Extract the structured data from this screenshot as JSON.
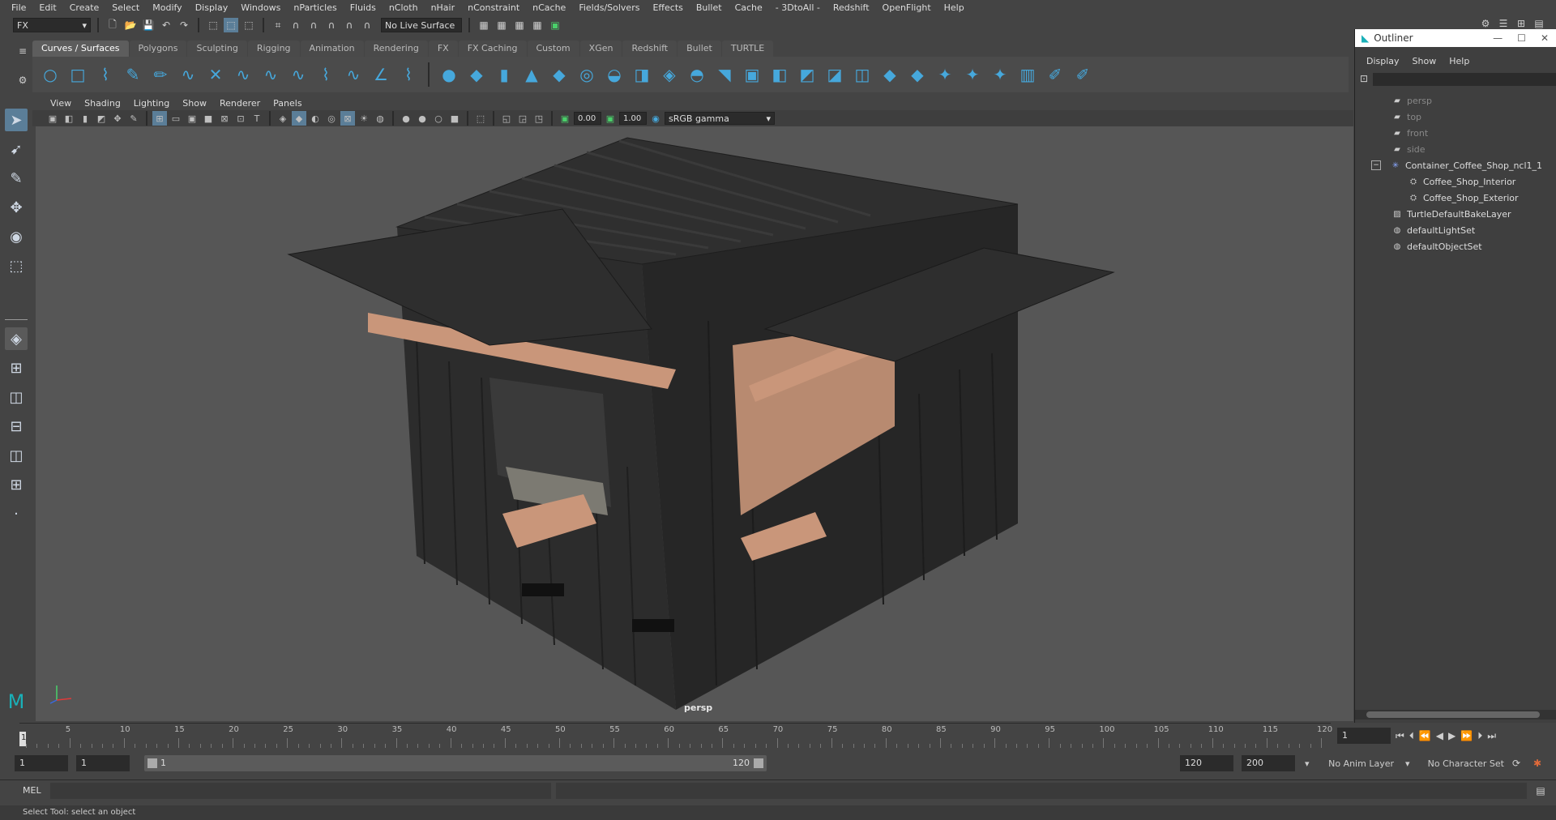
{
  "menubar": {
    "items": [
      "File",
      "Edit",
      "Create",
      "Select",
      "Modify",
      "Display",
      "Windows",
      "nParticles",
      "Fluids",
      "nCloth",
      "nHair",
      "nConstraint",
      "nCache",
      "Fields/Solvers",
      "Effects",
      "Bullet",
      "Cache",
      "- 3DtoAll -",
      "Redshift",
      "OpenFlight",
      "Help"
    ]
  },
  "toolbar": {
    "mode": "FX",
    "live_surface": "No Live Surface"
  },
  "shelf": {
    "tabs": [
      "Curves / Surfaces",
      "Polygons",
      "Sculpting",
      "Rigging",
      "Animation",
      "Rendering",
      "FX",
      "FX Caching",
      "Custom",
      "XGen",
      "Redshift",
      "Bullet",
      "TURTLE"
    ],
    "active_tab": "Curves / Surfaces"
  },
  "viewport": {
    "menu": [
      "View",
      "Shading",
      "Lighting",
      "Show",
      "Renderer",
      "Panels"
    ],
    "exposure": "0.00",
    "gamma": "1.00",
    "color_space": "sRGB gamma",
    "camera_label": "persp"
  },
  "outliner": {
    "title": "Outliner",
    "menu": [
      "Display",
      "Show",
      "Help"
    ],
    "items": [
      {
        "label": "persp",
        "indent": 0,
        "icon": "camera-icon",
        "dim": true
      },
      {
        "label": "top",
        "indent": 0,
        "icon": "camera-icon",
        "dim": true
      },
      {
        "label": "front",
        "indent": 0,
        "icon": "camera-icon",
        "dim": true
      },
      {
        "label": "side",
        "indent": 0,
        "icon": "camera-icon",
        "dim": true
      },
      {
        "label": "Container_Coffee_Shop_ncl1_1",
        "indent": 0,
        "icon": "group-icon",
        "dim": false,
        "expandable": true
      },
      {
        "label": "Coffee_Shop_Interior",
        "indent": 1,
        "icon": "mesh-icon",
        "dim": false
      },
      {
        "label": "Coffee_Shop_Exterior",
        "indent": 1,
        "icon": "mesh-icon",
        "dim": false
      },
      {
        "label": "TurtleDefaultBakeLayer",
        "indent": 0,
        "icon": "layer-icon",
        "dim": false
      },
      {
        "label": "defaultLightSet",
        "indent": 0,
        "icon": "set-icon",
        "dim": false
      },
      {
        "label": "defaultObjectSet",
        "indent": 0,
        "icon": "set-icon",
        "dim": false
      }
    ]
  },
  "timeline": {
    "start": 1,
    "end": 120,
    "labels": [
      "5",
      "10",
      "15",
      "20",
      "25",
      "30",
      "35",
      "40",
      "45",
      "50",
      "55",
      "60",
      "65",
      "70",
      "75",
      "80",
      "85",
      "90",
      "95",
      "100",
      "105",
      "110",
      "115",
      "120"
    ],
    "current_frame": "1",
    "first_frame_label": "1"
  },
  "range": {
    "start_field": "1",
    "playback_start": "1",
    "slider_start": "1",
    "slider_end": "120",
    "playback_end": "120",
    "end_field": "200",
    "anim_layer": "No Anim Layer",
    "character_set": "No Character Set"
  },
  "command": {
    "lang": "MEL"
  },
  "status": {
    "message": "Select Tool: select an object"
  },
  "colors": {
    "accent": "#46a8dc",
    "background": "#444444",
    "viewport_bg": "#565656",
    "container_dark": "#2a2a2a",
    "wood": "#c9967a"
  }
}
